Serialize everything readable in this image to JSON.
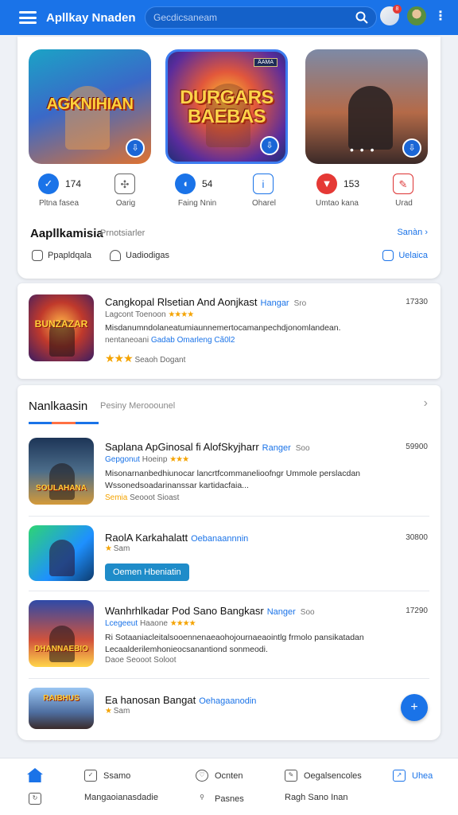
{
  "appbar": {
    "title": "Apllkay Nnaden",
    "search_placeholder": "Gecdicsaneam",
    "notification_count": "8",
    "more_label": "⋮"
  },
  "featured": {
    "tiles": [
      {
        "art_text": "AGKNIHIAN"
      },
      {
        "art_text": "DURGARS BAEBAS",
        "corner_label": "ÄAMA"
      },
      {
        "art_text": "",
        "dots": "• • •"
      }
    ],
    "stats": [
      {
        "value": "174",
        "label": "Pltna fasea",
        "icon": "shield-check-icon",
        "color": "#1a73e8"
      },
      {
        "value": "",
        "label": "Oarig",
        "icon": "puzzle-icon",
        "color": "#666666"
      },
      {
        "value": "54",
        "label": "Faing Nnin",
        "icon": "shield-icon",
        "color": "#1a73e8"
      },
      {
        "value": "",
        "label": "Oharel",
        "icon": "badge-icon",
        "color": "#1a73e8"
      },
      {
        "value": "153",
        "label": "Umtao kana",
        "icon": "flag-icon",
        "color": "#e53935"
      },
      {
        "value": "",
        "label": "Urad",
        "icon": "ribbon-icon",
        "color": "#d32f2f"
      }
    ],
    "section_title": "Aapllkamisia",
    "section_sub": "Prnotsiarler",
    "section_link": "Sanàn",
    "chips": [
      {
        "label": "Ppapldqala",
        "icon": "square-icon"
      },
      {
        "label": "Uadiodigas",
        "icon": "heart-icon"
      },
      {
        "label": "Uelaica",
        "icon": "bookmark-icon"
      }
    ]
  },
  "list1": {
    "title": "Cangkopal Rlsetian And Aonjkast",
    "tag": "Hangar",
    "soo": "Sro",
    "number": "17330",
    "meta_prefix": "Lagcont   Toenoon",
    "stars": "★★★★",
    "desc": "Misdanumndolaneatumiaunnemertocamanpechdjonomlandean.",
    "meta2": "nentaneoani",
    "meta2_blue": "Gadab Omarleng Cã0l2",
    "foot_stars": "★★★",
    "foot_text": "Seaoh  Dogant",
    "thumb_text": "BUNZAZAR"
  },
  "section2": {
    "title": "Nanlkaasin",
    "sub": "Pesiny Merooounel",
    "chevron": "›",
    "bar_colors": [
      "#1a73e8",
      "#ff7043",
      "#1a73e8"
    ]
  },
  "rows": [
    {
      "title": "Saplana ApGinosal fi AlofSkyjharr",
      "tag": "Ranger",
      "soo": "Soo",
      "number": "59900",
      "meta_blue": "Gepgonut",
      "meta": "Hoeinp",
      "stars": "★★★",
      "desc": "Misonarnanbedhiunocar lancrtfcommanelioofngr Ummole perslacdan Wssonedsoadarinanssar kartidacfaia...",
      "foot_blue": "Semia",
      "foot": "Seooot  Sioast",
      "thumb_text": "SOULAHANA"
    },
    {
      "title": "RaolA Karkahalatt",
      "tag": "Oebanaannnin",
      "soo": "",
      "number": "30800",
      "meta_blue": "",
      "meta": "Sam",
      "stars": "★",
      "desc": "",
      "button": "Oemen Hbeniatin",
      "thumb_text": ""
    },
    {
      "title": "Wanhrhlkadar Pod Sano Bangkasr",
      "tag": "Nanger",
      "soo": "Soo",
      "number": "17290",
      "meta_blue": "Lcegeeut",
      "meta": "Haaone",
      "stars": "★★★★",
      "desc": "Ri Sotaaniacleitalsooennenaeaohojournaeaointlg frmolo pansikatadan Lecaalderilemhonieocsanantiond sonmeodi.",
      "foot_blue": "",
      "foot": "Daoe  Seooot  Soloot",
      "thumb_text": "DHANNAEBIO"
    },
    {
      "title": "Ea hanosan Bangat",
      "tag": "Oehagaanodin",
      "soo": "",
      "number": "",
      "meta_blue": "",
      "meta": "Sam",
      "stars": "★",
      "desc": "",
      "thumb_text": "RAIBHUS"
    }
  ],
  "fab_label": "+",
  "bottomnav": {
    "row1": [
      {
        "label": "",
        "icon": "home-icon",
        "active": true
      },
      {
        "label": "Ssamo",
        "icon": "checkbox-icon"
      },
      {
        "label": "Ocnten",
        "icon": "heart-icon"
      },
      {
        "label": "Oegalsencoles",
        "icon": "edit-icon"
      },
      {
        "label": "Uhea",
        "icon": "share-icon",
        "active": true
      }
    ],
    "row2": [
      {
        "label": "",
        "icon": "refresh-icon"
      },
      {
        "label": "Mangaoianasdadie",
        "icon": ""
      },
      {
        "label": "Pasnes",
        "icon": "pin-icon"
      },
      {
        "label": "Ragh Sano Inan",
        "icon": ""
      }
    ]
  }
}
